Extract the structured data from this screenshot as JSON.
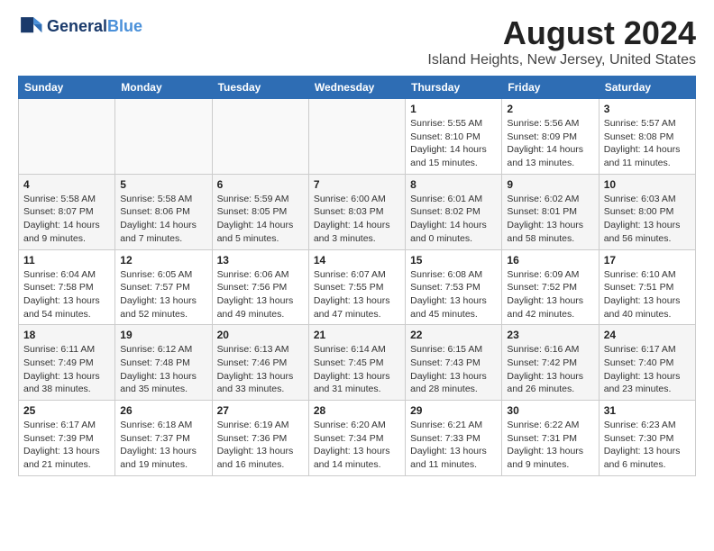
{
  "header": {
    "logo_line1": "General",
    "logo_line2": "Blue",
    "month": "August 2024",
    "location": "Island Heights, New Jersey, United States"
  },
  "weekdays": [
    "Sunday",
    "Monday",
    "Tuesday",
    "Wednesday",
    "Thursday",
    "Friday",
    "Saturday"
  ],
  "weeks": [
    [
      {
        "day": "",
        "info": ""
      },
      {
        "day": "",
        "info": ""
      },
      {
        "day": "",
        "info": ""
      },
      {
        "day": "",
        "info": ""
      },
      {
        "day": "1",
        "info": "Sunrise: 5:55 AM\nSunset: 8:10 PM\nDaylight: 14 hours\nand 15 minutes."
      },
      {
        "day": "2",
        "info": "Sunrise: 5:56 AM\nSunset: 8:09 PM\nDaylight: 14 hours\nand 13 minutes."
      },
      {
        "day": "3",
        "info": "Sunrise: 5:57 AM\nSunset: 8:08 PM\nDaylight: 14 hours\nand 11 minutes."
      }
    ],
    [
      {
        "day": "4",
        "info": "Sunrise: 5:58 AM\nSunset: 8:07 PM\nDaylight: 14 hours\nand 9 minutes."
      },
      {
        "day": "5",
        "info": "Sunrise: 5:58 AM\nSunset: 8:06 PM\nDaylight: 14 hours\nand 7 minutes."
      },
      {
        "day": "6",
        "info": "Sunrise: 5:59 AM\nSunset: 8:05 PM\nDaylight: 14 hours\nand 5 minutes."
      },
      {
        "day": "7",
        "info": "Sunrise: 6:00 AM\nSunset: 8:03 PM\nDaylight: 14 hours\nand 3 minutes."
      },
      {
        "day": "8",
        "info": "Sunrise: 6:01 AM\nSunset: 8:02 PM\nDaylight: 14 hours\nand 0 minutes."
      },
      {
        "day": "9",
        "info": "Sunrise: 6:02 AM\nSunset: 8:01 PM\nDaylight: 13 hours\nand 58 minutes."
      },
      {
        "day": "10",
        "info": "Sunrise: 6:03 AM\nSunset: 8:00 PM\nDaylight: 13 hours\nand 56 minutes."
      }
    ],
    [
      {
        "day": "11",
        "info": "Sunrise: 6:04 AM\nSunset: 7:58 PM\nDaylight: 13 hours\nand 54 minutes."
      },
      {
        "day": "12",
        "info": "Sunrise: 6:05 AM\nSunset: 7:57 PM\nDaylight: 13 hours\nand 52 minutes."
      },
      {
        "day": "13",
        "info": "Sunrise: 6:06 AM\nSunset: 7:56 PM\nDaylight: 13 hours\nand 49 minutes."
      },
      {
        "day": "14",
        "info": "Sunrise: 6:07 AM\nSunset: 7:55 PM\nDaylight: 13 hours\nand 47 minutes."
      },
      {
        "day": "15",
        "info": "Sunrise: 6:08 AM\nSunset: 7:53 PM\nDaylight: 13 hours\nand 45 minutes."
      },
      {
        "day": "16",
        "info": "Sunrise: 6:09 AM\nSunset: 7:52 PM\nDaylight: 13 hours\nand 42 minutes."
      },
      {
        "day": "17",
        "info": "Sunrise: 6:10 AM\nSunset: 7:51 PM\nDaylight: 13 hours\nand 40 minutes."
      }
    ],
    [
      {
        "day": "18",
        "info": "Sunrise: 6:11 AM\nSunset: 7:49 PM\nDaylight: 13 hours\nand 38 minutes."
      },
      {
        "day": "19",
        "info": "Sunrise: 6:12 AM\nSunset: 7:48 PM\nDaylight: 13 hours\nand 35 minutes."
      },
      {
        "day": "20",
        "info": "Sunrise: 6:13 AM\nSunset: 7:46 PM\nDaylight: 13 hours\nand 33 minutes."
      },
      {
        "day": "21",
        "info": "Sunrise: 6:14 AM\nSunset: 7:45 PM\nDaylight: 13 hours\nand 31 minutes."
      },
      {
        "day": "22",
        "info": "Sunrise: 6:15 AM\nSunset: 7:43 PM\nDaylight: 13 hours\nand 28 minutes."
      },
      {
        "day": "23",
        "info": "Sunrise: 6:16 AM\nSunset: 7:42 PM\nDaylight: 13 hours\nand 26 minutes."
      },
      {
        "day": "24",
        "info": "Sunrise: 6:17 AM\nSunset: 7:40 PM\nDaylight: 13 hours\nand 23 minutes."
      }
    ],
    [
      {
        "day": "25",
        "info": "Sunrise: 6:17 AM\nSunset: 7:39 PM\nDaylight: 13 hours\nand 21 minutes."
      },
      {
        "day": "26",
        "info": "Sunrise: 6:18 AM\nSunset: 7:37 PM\nDaylight: 13 hours\nand 19 minutes."
      },
      {
        "day": "27",
        "info": "Sunrise: 6:19 AM\nSunset: 7:36 PM\nDaylight: 13 hours\nand 16 minutes."
      },
      {
        "day": "28",
        "info": "Sunrise: 6:20 AM\nSunset: 7:34 PM\nDaylight: 13 hours\nand 14 minutes."
      },
      {
        "day": "29",
        "info": "Sunrise: 6:21 AM\nSunset: 7:33 PM\nDaylight: 13 hours\nand 11 minutes."
      },
      {
        "day": "30",
        "info": "Sunrise: 6:22 AM\nSunset: 7:31 PM\nDaylight: 13 hours\nand 9 minutes."
      },
      {
        "day": "31",
        "info": "Sunrise: 6:23 AM\nSunset: 7:30 PM\nDaylight: 13 hours\nand 6 minutes."
      }
    ]
  ]
}
